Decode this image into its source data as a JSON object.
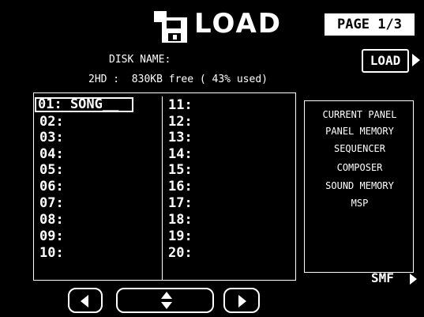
{
  "header": {
    "title": "LOAD",
    "icon": "floppy-disk-icon",
    "page_indicator": "PAGE 1/3"
  },
  "disk": {
    "name_label": "DISK NAME:",
    "info": "2HD :  830KB free ( 43% used)"
  },
  "buttons": {
    "load": "LOAD",
    "smf": "SMF"
  },
  "files": {
    "left": [
      "01: SONG__",
      "02:",
      "03:",
      "04:",
      "05:",
      "06:",
      "07:",
      "08:",
      "09:",
      "10:"
    ],
    "right": [
      "11:",
      "12:",
      "13:",
      "14:",
      "15:",
      "16:",
      "17:",
      "18:",
      "19:",
      "20:"
    ]
  },
  "categories": [
    "CURRENT PANEL",
    "PANEL MEMORY",
    "SEQUENCER",
    "COMPOSER",
    "SOUND MEMORY",
    "MSP"
  ],
  "colors": {
    "background": "#000000",
    "foreground": "#ffffff"
  }
}
